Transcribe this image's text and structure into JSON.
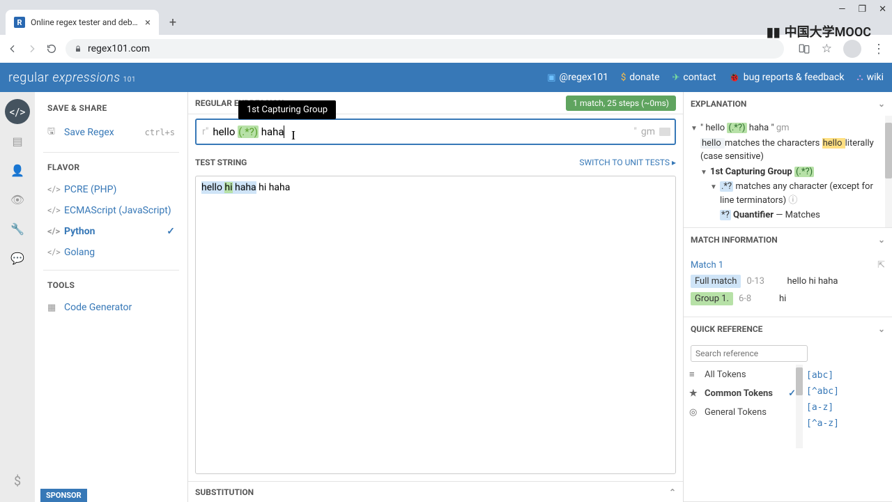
{
  "browser": {
    "tab_title": "Online regex tester and debu…",
    "url_host": "regex101.com",
    "favicon_letter": "R"
  },
  "watermark": "中国大学MOOC",
  "header": {
    "logo_regular": "regular",
    "logo_expressions": "expressions",
    "logo_101": "101",
    "links": {
      "twitter": "@regex101",
      "donate": "donate",
      "contact": "contact",
      "bugs": "bug reports & feedback",
      "wiki": "wiki"
    }
  },
  "left": {
    "save_share": "SAVE & SHARE",
    "save_regex": "Save Regex",
    "save_shortcut": "ctrl+s",
    "flavor": "FLAVOR",
    "flavors": {
      "pcre": "PCRE (PHP)",
      "ecma": "ECMAScript (JavaScript)",
      "python": "Python",
      "golang": "Golang"
    },
    "tools": "TOOLS",
    "codegen": "Code Generator",
    "sponsor": "SPONSOR"
  },
  "center": {
    "regex_header": "REGULAR EXPRESSION",
    "match_badge": "1 match, 25 steps (~0ms)",
    "tooltip": "1st Capturing Group",
    "prefix": "r\"",
    "regex_text_before": "hello ",
    "regex_group": "(.*?)",
    "regex_text_after": " haha",
    "flags_quote": "\"",
    "flags": "gm",
    "test_header": "TEST STRING",
    "switch_tests": "SWITCH TO UNIT TESTS ▸",
    "test_before_match": "",
    "test_m_before_g": "hello ",
    "test_m_g1": "hi",
    "test_m_after_g": " haha",
    "test_after_match": " hi haha",
    "substitution": "SUBSTITUTION"
  },
  "right": {
    "explanation": "EXPLANATION",
    "exp_full_pre": "\" hello ",
    "exp_full_group": "(.*?)",
    "exp_full_post": " haha \"",
    "exp_full_flags": "gm",
    "exp_hello_lit": "hello ",
    "exp_hello_desc": "matches the characters ",
    "exp_hello_hl": "hello ",
    "exp_literal": "literally (case sensitive)",
    "exp_group_title": "1st Capturing Group ",
    "exp_group_token": "(.*?)",
    "exp_any_token": ".*?",
    "exp_any_desc": "matches any character (except for line terminators)",
    "exp_quant_token": "*?",
    "exp_quant_label": "Quantifier",
    "exp_quant_desc": "— Matches",
    "match_info": "MATCH INFORMATION",
    "match1": "Match 1",
    "full_match": "Full match",
    "full_range": "0-13",
    "full_text": "hello hi haha",
    "g1_label": "Group 1.",
    "g1_range": "6-8",
    "g1_text": "hi",
    "quick_ref": "QUICK REFERENCE",
    "search_ph": "Search reference",
    "qr_all": "All Tokens",
    "qr_common": "Common Tokens",
    "qr_general": "General Tokens",
    "tok1": "[abc]",
    "tok2": "[^abc]",
    "tok3": "[a-z]",
    "tok4": "[^a-z]"
  }
}
